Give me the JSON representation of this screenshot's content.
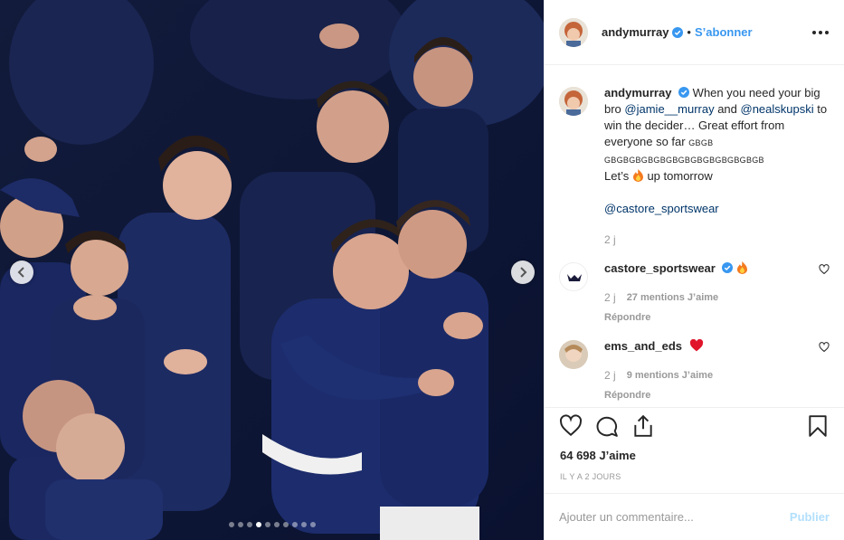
{
  "post": {
    "image_alt": "",
    "carousel": {
      "dot_count": 10,
      "active_index": 3
    }
  },
  "header": {
    "username": "andymurray",
    "separator": "•",
    "follow_label": "S’abonner"
  },
  "caption": {
    "username": "andymurray",
    "text_1": "When you need your big bro ",
    "mention_1": "@jamie__murray",
    "text_2": " and ",
    "mention_2": "@nealskupski",
    "text_3": " to win the decider… Great effort from everyone so far ",
    "gbgb_1": "GBGB",
    "gbgb_2": "GBGBGBGBGBGBGBGBGBGBGBGBGB",
    "text_4": "Let’s ",
    "text_5": " up tomorrow",
    "mention_3": "@castore_sportswear",
    "time": "2 j"
  },
  "comments": [
    {
      "username": "castore_sportswear",
      "time": "2 j",
      "likes": "27 mentions J’aime",
      "reply": "Répondre"
    },
    {
      "username": "ems_and_eds",
      "time": "2 j",
      "likes": "9 mentions J’aime",
      "reply": "Répondre"
    }
  ],
  "footer": {
    "likes_total": "64 698 J’aime",
    "timestamp": "IL Y A 2 JOURS",
    "comment_placeholder": "Ajouter un commentaire...",
    "publish_label": "Publier"
  },
  "colors": {
    "accent": "#3897f0",
    "mention": "#003569",
    "meta": "#999999",
    "heart_red": "#ed4956"
  }
}
